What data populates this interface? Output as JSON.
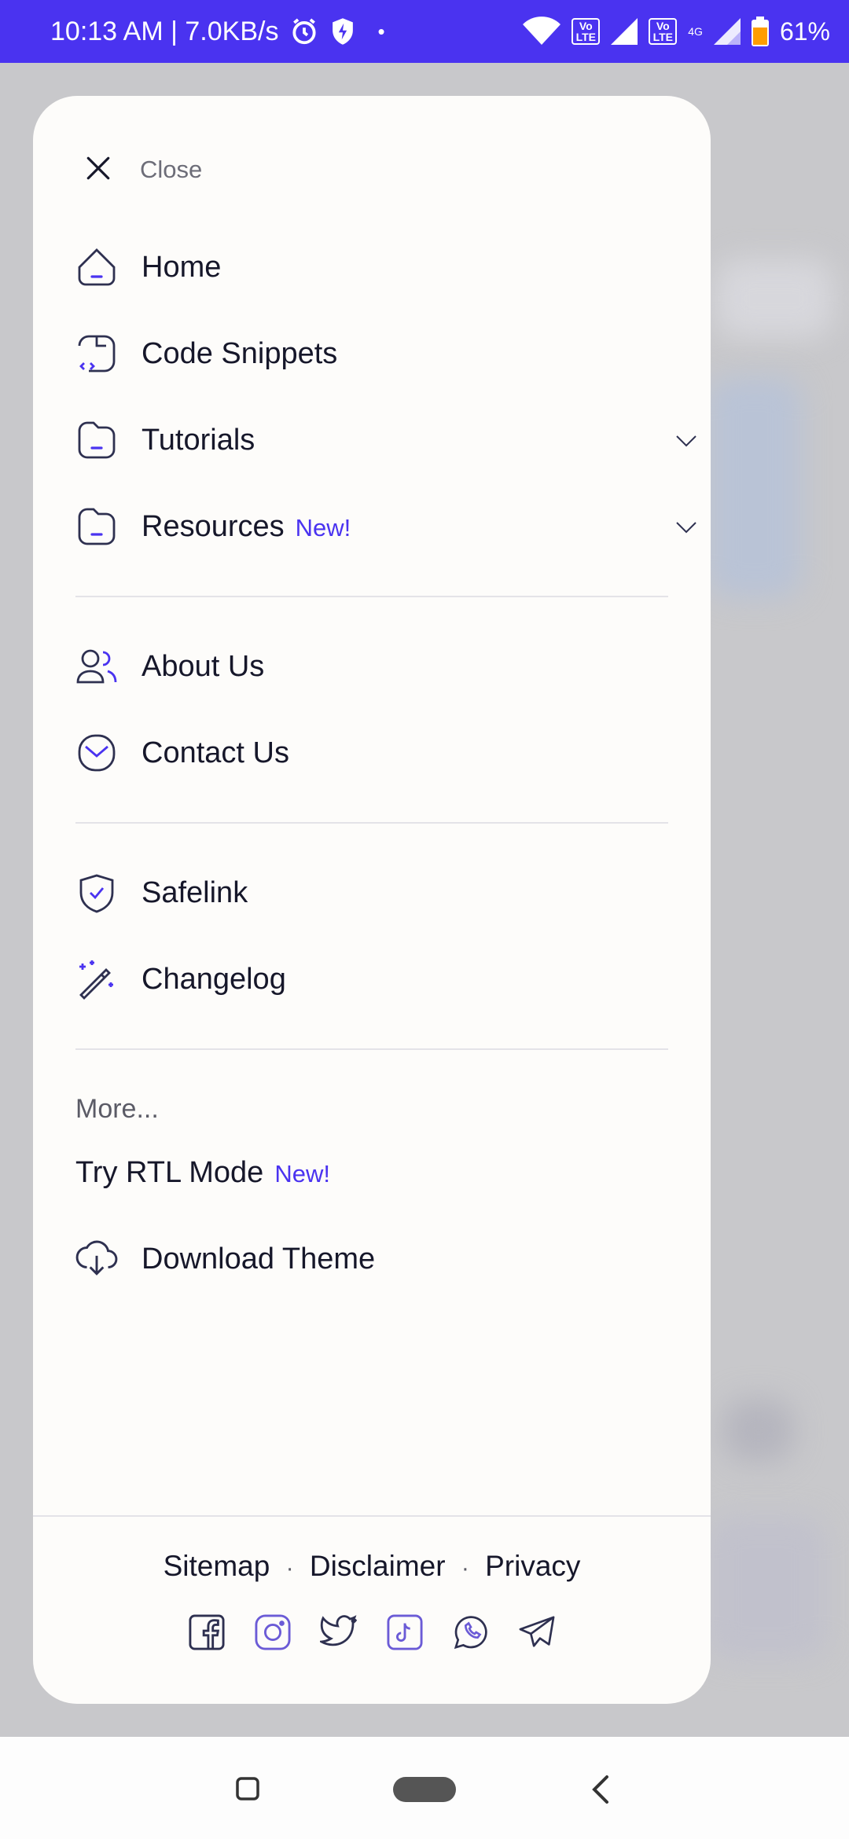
{
  "status_bar": {
    "time_speed": "10:13 AM | 7.0KB/s",
    "dot": "•",
    "volte_1": "Vo LTE",
    "volte_2": "Vo LTE",
    "net_type": "4G",
    "battery": "61%",
    "icons": [
      "alarm-icon",
      "shield-bolt-icon",
      "wifi-icon",
      "signal-icon",
      "battery-icon"
    ]
  },
  "drawer": {
    "close_label": "Close",
    "items": [
      {
        "label": "Home",
        "icon": "home-icon"
      },
      {
        "label": "Code Snippets",
        "icon": "code-file-icon"
      },
      {
        "label": "Tutorials",
        "icon": "folder-icon",
        "has_dropdown": true
      },
      {
        "label": "Resources",
        "icon": "folder-icon",
        "badge": "New!",
        "has_dropdown": true
      },
      {
        "label": "About Us",
        "icon": "users-icon"
      },
      {
        "label": "Contact Us",
        "icon": "mail-icon"
      },
      {
        "label": "Safelink",
        "icon": "shield-check-icon"
      },
      {
        "label": "Changelog",
        "icon": "magic-wand-icon"
      }
    ],
    "more_label": "More...",
    "rtl": {
      "label": "Try RTL Mode",
      "badge": "New!"
    },
    "download": {
      "label": "Download Theme",
      "icon": "cloud-download-icon"
    },
    "footer": {
      "links": [
        "Sitemap",
        "Disclaimer",
        "Privacy"
      ],
      "separator": "·",
      "socials": [
        "facebook-icon",
        "instagram-icon",
        "twitter-icon",
        "tiktok-icon",
        "whatsapp-icon",
        "telegram-icon"
      ]
    }
  },
  "colors": {
    "accent": "#4a33f0",
    "text": "#16172a",
    "muted": "#6d6d78",
    "icon_stroke": "#2e3050"
  }
}
